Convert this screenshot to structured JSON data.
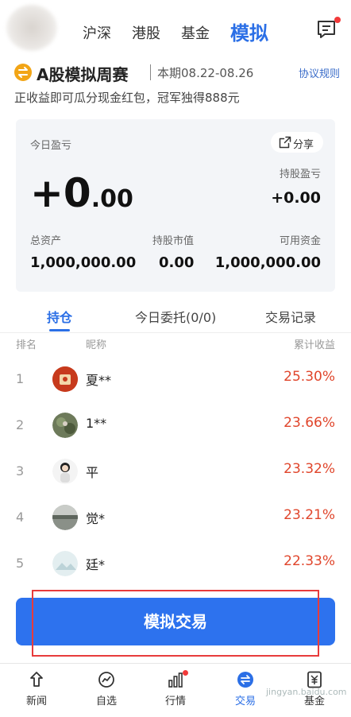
{
  "header": {
    "tabs": [
      {
        "label": "沪深",
        "active": false
      },
      {
        "label": "港股",
        "active": false
      },
      {
        "label": "基金",
        "active": false
      },
      {
        "label": "模拟",
        "active": true
      }
    ],
    "message_icon": "message-icon",
    "has_unread": true
  },
  "contest": {
    "title": "A股模拟周赛",
    "period": "本期08.22-08.26",
    "rules_link": "协议规则",
    "subtitle": "正收益即可瓜分现金红包，冠军独得888元"
  },
  "summary": {
    "today_pnl_label": "今日盈亏",
    "share_label": "分享",
    "today_pnl_int": "+0",
    "today_pnl_dec": ".00",
    "holding_pnl_label": "持股盈亏",
    "holding_pnl": "+0.00",
    "total_assets_label": "总资产",
    "total_assets": "1,000,000.00",
    "market_value_label": "持股市值",
    "market_value": "0.00",
    "available_label": "可用资金",
    "available": "1,000,000.00"
  },
  "tabs": [
    {
      "label": "持仓",
      "active": true
    },
    {
      "label": "今日委托(0/0)",
      "active": false
    },
    {
      "label": "交易记录",
      "active": false
    }
  ],
  "table": {
    "headers": [
      "排名",
      "昵称",
      "累计收益"
    ],
    "rows": [
      {
        "rank": "1",
        "nickname": "夏**",
        "return": "25.30%"
      },
      {
        "rank": "2",
        "nickname": "1**",
        "return": "23.66%"
      },
      {
        "rank": "3",
        "nickname": "平",
        "return": "23.32%"
      },
      {
        "rank": "4",
        "nickname": "觉*",
        "return": "23.21%"
      },
      {
        "rank": "5",
        "nickname": "廷*",
        "return": "22.33%"
      }
    ]
  },
  "trade_button": "模拟交易",
  "bottom_nav": [
    {
      "label": "新闻",
      "icon": "news-icon",
      "active": false
    },
    {
      "label": "自选",
      "icon": "watchlist-icon",
      "active": false
    },
    {
      "label": "行情",
      "icon": "market-icon",
      "active": false,
      "dot": true
    },
    {
      "label": "交易",
      "icon": "trade-icon",
      "active": true
    },
    {
      "label": "基金",
      "icon": "fund-icon",
      "active": false
    }
  ],
  "watermark": "jingyan.baidu.com",
  "colors": {
    "accent": "#2b6fe6",
    "gain": "#e0452b",
    "button": "#2d72ee",
    "badge": "#f2a516"
  }
}
